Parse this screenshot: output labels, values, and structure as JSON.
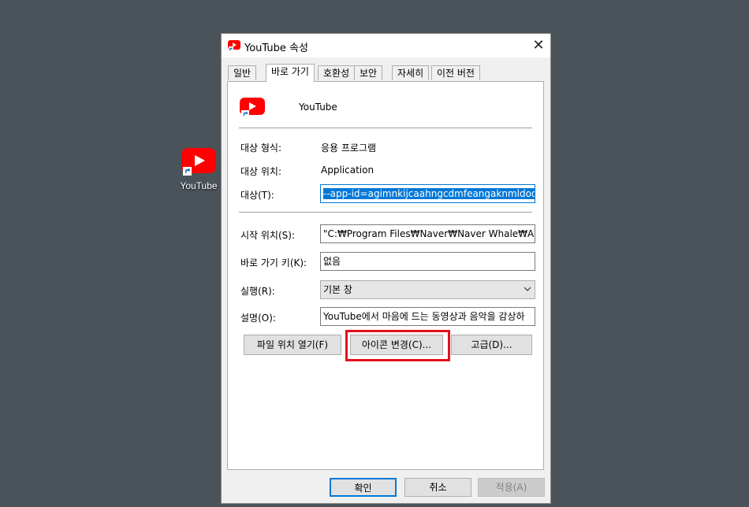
{
  "desktop": {
    "icon_label": "YouTube",
    "icon": "youtube-icon"
  },
  "dialog": {
    "title": "YouTube 속성",
    "close_glyph": "✕",
    "tabs": [
      {
        "label": "일반",
        "active": false
      },
      {
        "label": "바로 가기",
        "active": true
      },
      {
        "label": "호환성",
        "active": false
      },
      {
        "label": "보안",
        "active": false
      },
      {
        "label": "자세히",
        "active": false
      },
      {
        "label": "이전 버전",
        "active": false
      }
    ],
    "app_name": "YouTube",
    "target_type": {
      "label": "대상 형식:",
      "value": "응용 프로그램"
    },
    "target_location": {
      "label": "대상 위치:",
      "value": "Application"
    },
    "target": {
      "label": "대상(T):",
      "value": "--app-id=agimnkijcaahngcdmfeangaknmldooml"
    },
    "start_in": {
      "label": "시작 위치(S):",
      "value": "\"C:₩Program Files₩Naver₩Naver Whale₩Applicat"
    },
    "shortcut_key": {
      "label": "바로 가기 키(K):",
      "value": "없음"
    },
    "run": {
      "label": "실행(R):",
      "value": "기본 창"
    },
    "comment": {
      "label": "설명(O):",
      "value": "YouTube에서 마음에 드는 동영상과 음악을 감상하"
    },
    "buttons": {
      "open_location": "파일 위치 열기(F)",
      "change_icon": "아이콘 변경(C)...",
      "advanced": "고급(D)..."
    },
    "footer": {
      "ok": "확인",
      "cancel": "취소",
      "apply": "적용(A)"
    },
    "colors": {
      "accent": "#0078d7",
      "highlight": "#e3101d",
      "youtube_red": "#ff0000"
    }
  }
}
